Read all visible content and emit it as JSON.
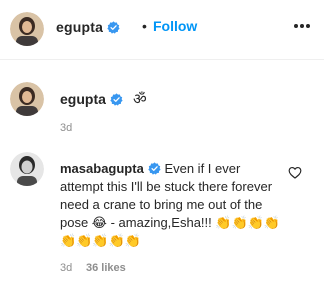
{
  "header": {
    "username": "egupta",
    "separator": "•",
    "follow_label": "Follow",
    "more_icon": "more-horizontal-icon"
  },
  "caption": {
    "username": "egupta",
    "text": "ॐ",
    "time": "3d"
  },
  "comment": {
    "username": "masabagupta",
    "text": "Even if I ever attempt this I'll be stuck there forever need a crane to bring me out of the pose 😂 - amazing,Esha!!! 👏👏👏👏👏👏👏👏👏",
    "time": "3d",
    "likes": "36 likes",
    "like_icon": "heart-outline-icon"
  },
  "colors": {
    "accent": "#0095f6",
    "muted": "#8e8e8e",
    "text": "#262626"
  }
}
